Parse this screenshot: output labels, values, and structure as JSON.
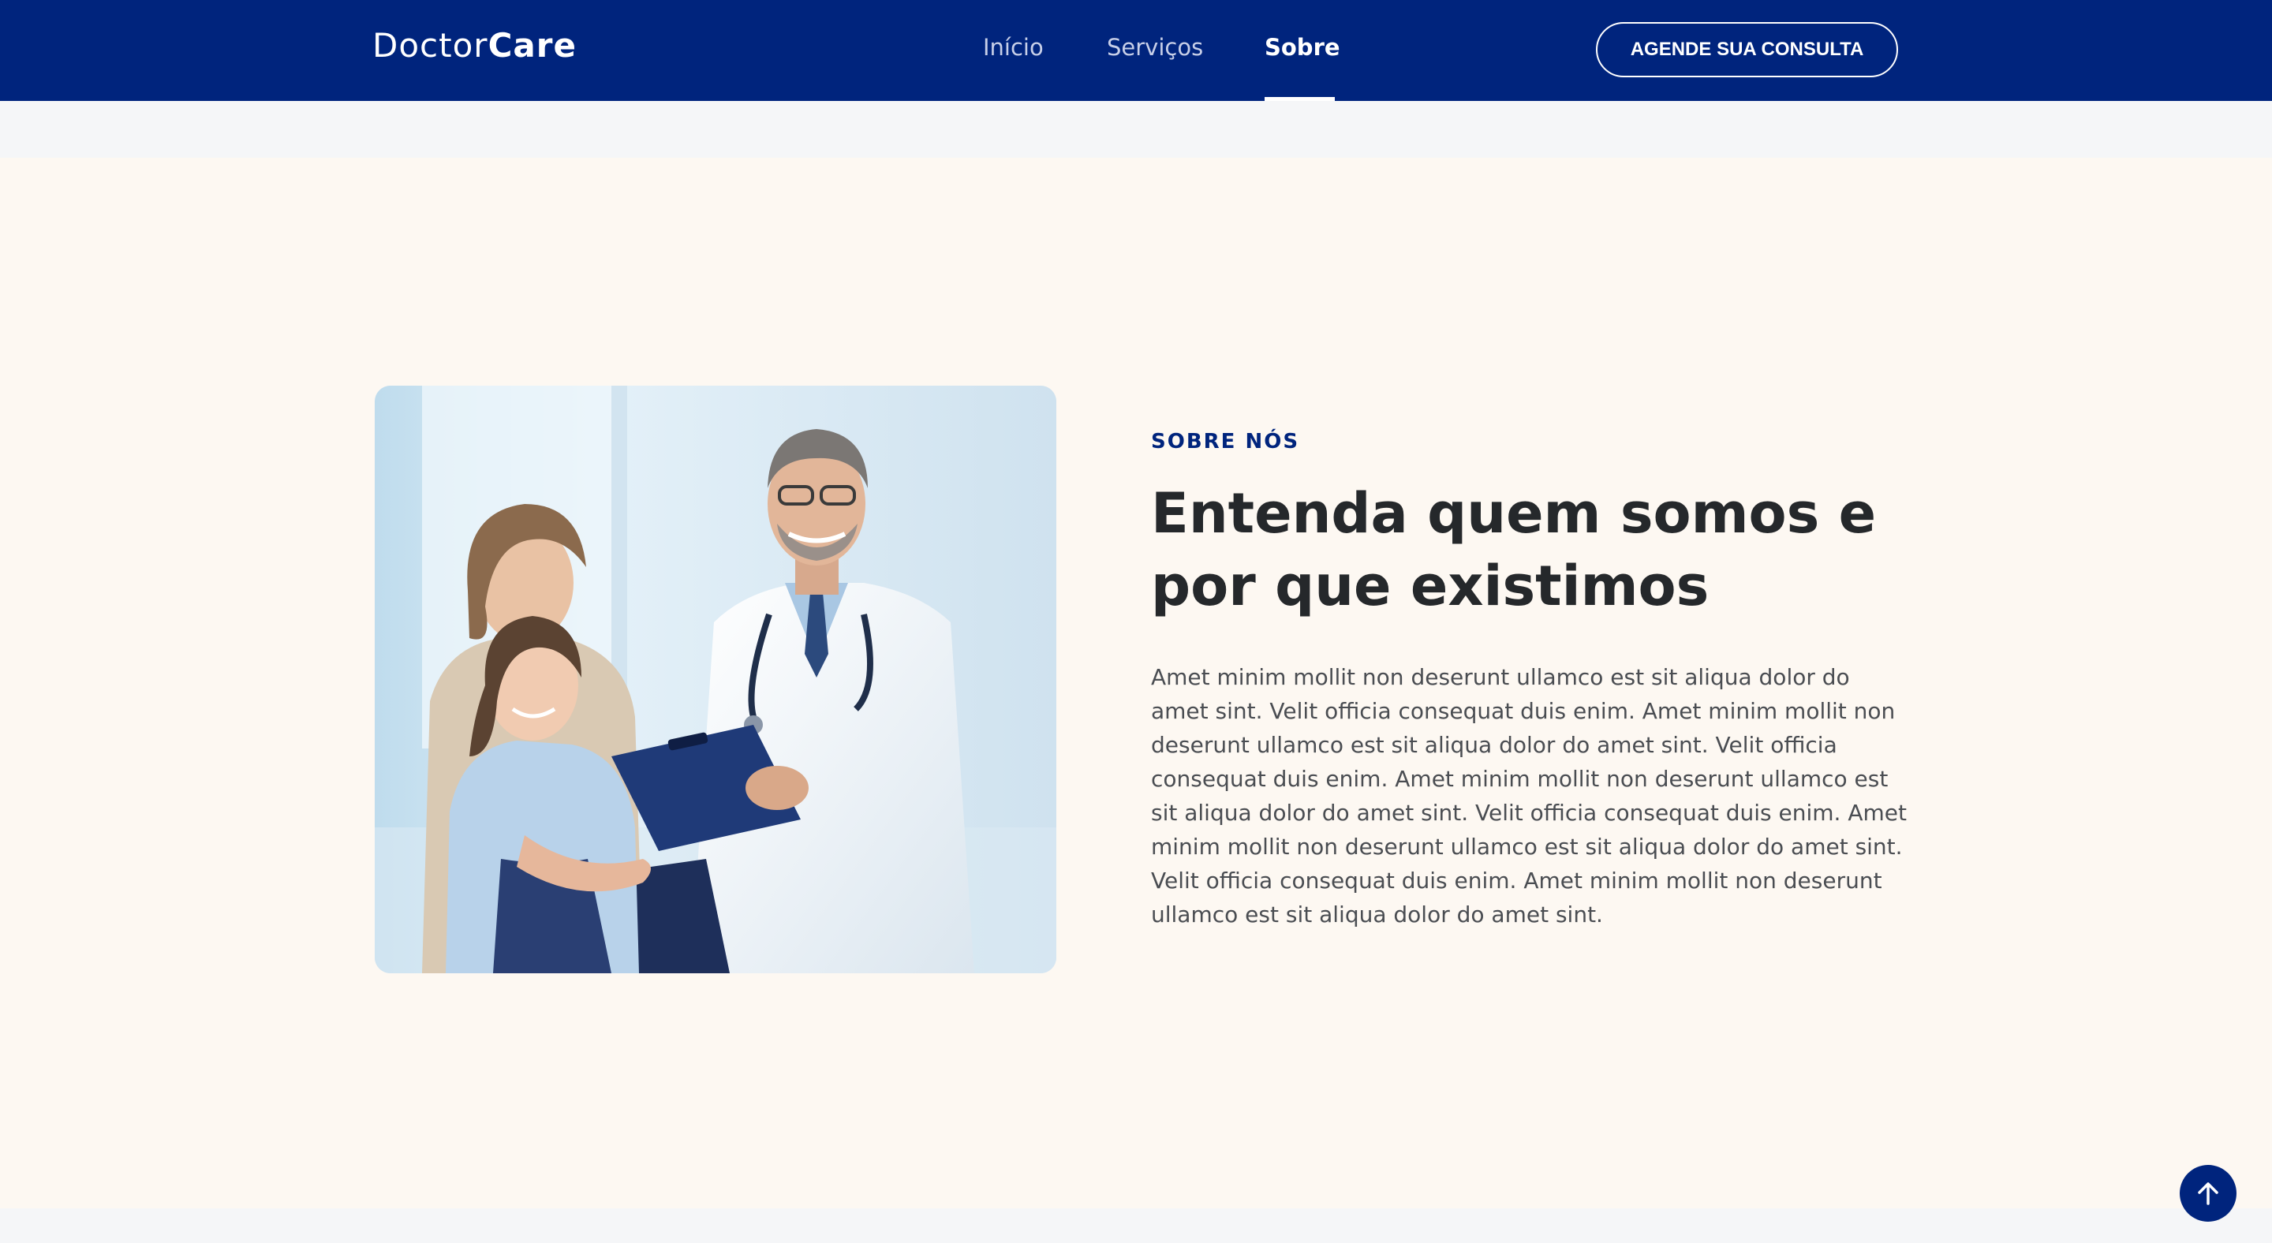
{
  "header": {
    "logo_light": "Doctor",
    "logo_bold": "Care",
    "nav": [
      {
        "label": "Início",
        "active": false
      },
      {
        "label": "Serviços",
        "active": false
      },
      {
        "label": "Sobre",
        "active": true
      }
    ],
    "cta_label": "AGENDE SUA CONSULTA"
  },
  "about": {
    "eyebrow": "SOBRE NÓS",
    "heading_line1": "Entenda quem somos e",
    "heading_line2": "por que existimos",
    "body": "Amet minim mollit non deserunt ullamco est sit aliqua dolor do amet sint. Velit officia consequat duis enim. Amet minim mollit non deserunt ullamco est sit aliqua dolor do amet sint. Velit officia consequat duis enim. Amet minim mollit non deserunt ullamco est sit aliqua dolor do amet sint. Velit officia consequat duis enim. Amet minim mollit non deserunt ullamco est sit aliqua dolor do amet sint. Velit officia consequat duis enim. Amet minim mollit non deserunt ullamco est sit aliqua dolor do amet sint."
  },
  "icons": {
    "back_to_top": "arrow-up-icon"
  },
  "colors": {
    "brand": "#00247d",
    "section_bg": "#fdf8f2",
    "page_bg": "#f5f6f8",
    "heading": "#25282b",
    "body": "#4a4d52"
  }
}
